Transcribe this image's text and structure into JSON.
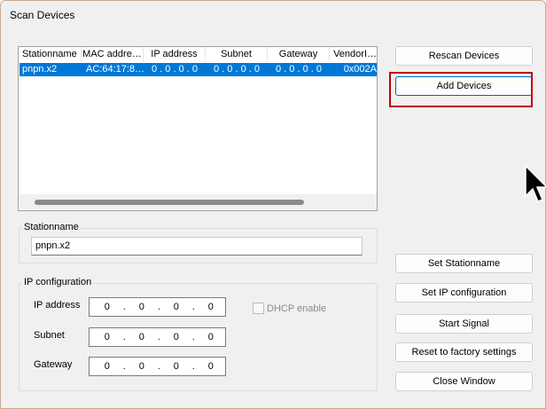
{
  "window": {
    "title": "Scan Devices"
  },
  "device_table": {
    "columns": [
      "Stationname",
      "MAC addre…",
      "IP address",
      "Subnet",
      "Gateway",
      "VendorI…"
    ],
    "rows": [
      [
        "pnpn.x2",
        "AC:64:17:8…",
        "0 . 0 . 0 . 0",
        "0 . 0 . 0 . 0",
        "0 . 0 . 0 . 0",
        "0x002A"
      ]
    ]
  },
  "stationname_group": {
    "label": "Stationname",
    "value": "pnpn.x2"
  },
  "ip_config": {
    "label": "IP configuration",
    "ip_address": {
      "label": "IP address",
      "octets": [
        "0",
        "0",
        "0",
        "0"
      ]
    },
    "subnet": {
      "label": "Subnet",
      "octets": [
        "0",
        "0",
        "0",
        "0"
      ]
    },
    "gateway": {
      "label": "Gateway",
      "octets": [
        "0",
        "0",
        "0",
        "0"
      ]
    },
    "dhcp": {
      "label": "DHCP enable",
      "checked": false,
      "enabled": false
    }
  },
  "buttons": {
    "rescan": "Rescan Devices",
    "add": "Add Devices",
    "set_stationname": "Set Stationname",
    "set_ip": "Set IP configuration",
    "start_signal": "Start Signal",
    "reset": "Reset to factory settings",
    "close": "Close Window"
  },
  "colors": {
    "selection": "#0078d7",
    "highlight_frame": "#c00000",
    "window_bg": "#f0f0f0"
  }
}
